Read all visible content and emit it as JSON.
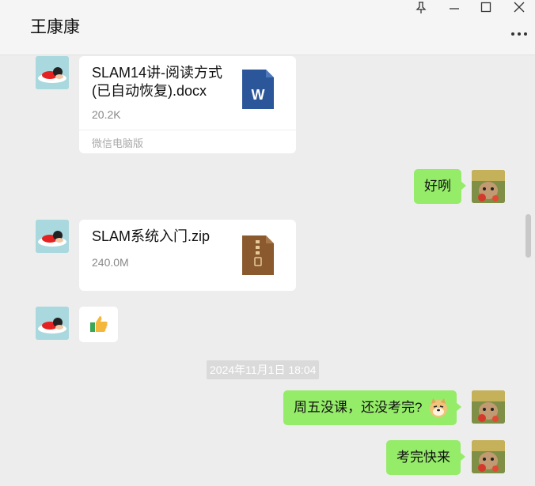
{
  "header": {
    "contact_name": "王康康",
    "pin_icon": "pin-icon",
    "more_glyph": "•••"
  },
  "messages": {
    "file1": {
      "name": "SLAM14讲-阅读方式(已自动恢复).docx",
      "size": "20.2K",
      "source": "微信电脑版",
      "icon": "word-doc-icon"
    },
    "reply1": {
      "text": "好咧"
    },
    "file2": {
      "name": "SLAM系统入门.zip",
      "size": "240.0M",
      "icon": "zip-icon"
    },
    "thumbs": {
      "emoji": "👍"
    },
    "timestamp": "2024年11月1日 18:04",
    "reply2": {
      "text": "周五没课，还没考完?",
      "emoji": "doge-emoji"
    },
    "reply3": {
      "text": "考完快来"
    }
  },
  "colors": {
    "green_bubble": "#95ec69",
    "chat_background": "#ededed",
    "word_blue": "#2b579a",
    "zip_brown": "#8a5a2e"
  }
}
